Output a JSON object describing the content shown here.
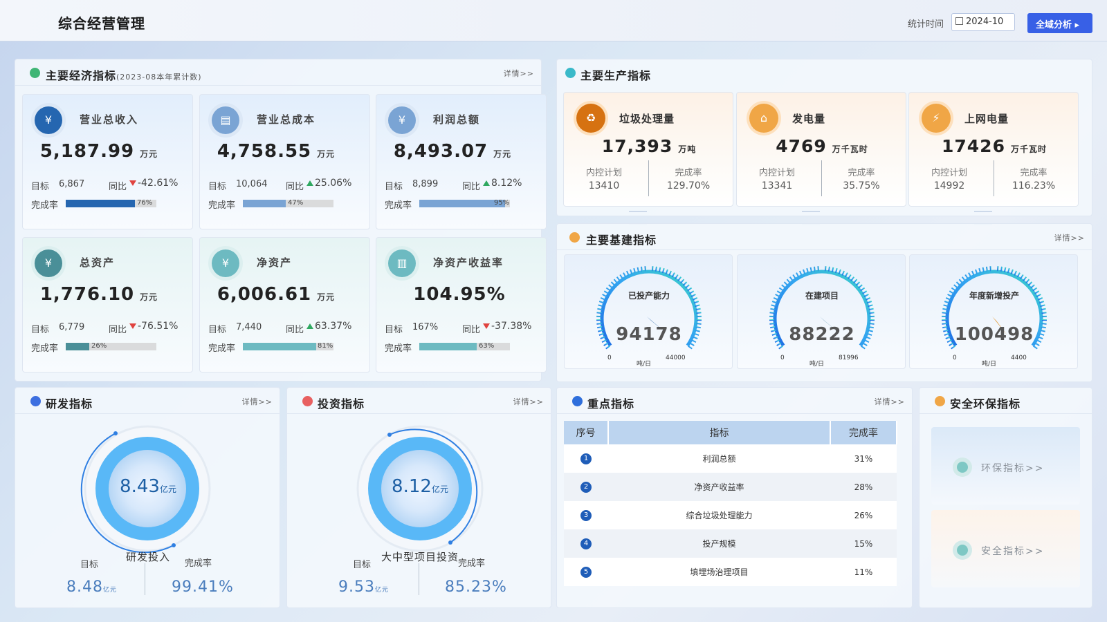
{
  "header": {
    "title": "综合经营管理",
    "stat_label": "统计时间",
    "date": "2024-10",
    "analyze_button": "全域分析 ▸"
  },
  "economic": {
    "title": "主要经济指标",
    "subtitle": "(2023-08本年累计数)",
    "more": "详情>>",
    "cards": [
      {
        "name": "营业总收入",
        "value": "5,187.99",
        "unit": "万元",
        "target_label": "目标",
        "target": "6,867",
        "yoy_label": "同比",
        "yoy_dir": "down",
        "yoy": "-42.61%",
        "rate_label": "完成率",
        "rate": 0.76,
        "rate_text": "76%",
        "color": "#2566b0",
        "icon": "wallet-icon"
      },
      {
        "name": "营业总成本",
        "value": "4,758.55",
        "unit": "万元",
        "target_label": "目标",
        "target": "10,064",
        "yoy_label": "同比",
        "yoy_dir": "up",
        "yoy": "25.06%",
        "rate_label": "完成率",
        "rate": 0.47,
        "rate_text": "47%",
        "color": "#7aa4d4",
        "icon": "printer-icon"
      },
      {
        "name": "利润总额",
        "value": "8,493.07",
        "unit": "万元",
        "target_label": "目标",
        "target": "8,899",
        "yoy_label": "同比",
        "yoy_dir": "up",
        "yoy": "8.12%",
        "rate_label": "完成率",
        "rate": 0.95,
        "rate_text": "95%",
        "color": "#7aa4d4",
        "icon": "yen-coin-icon"
      },
      {
        "name": "总资产",
        "value": "1,776.10",
        "unit": "万元",
        "target_label": "目标",
        "target": "6,779",
        "yoy_label": "同比",
        "yoy_dir": "down",
        "yoy": "-76.51%",
        "rate_label": "完成率",
        "rate": 0.26,
        "rate_text": "26%",
        "color": "#4a8f98",
        "icon": "ledger-icon"
      },
      {
        "name": "净资产",
        "value": "6,006.61",
        "unit": "万元",
        "target_label": "目标",
        "target": "7,440",
        "yoy_label": "同比",
        "yoy_dir": "up",
        "yoy": "63.37%",
        "rate_label": "完成率",
        "rate": 0.81,
        "rate_text": "81%",
        "color": "#6dbac1",
        "icon": "purse-icon"
      },
      {
        "name": "净资产收益率",
        "value": "104.95%",
        "unit": "",
        "target_label": "目标",
        "target": "167%",
        "yoy_label": "同比",
        "yoy_dir": "down",
        "yoy": "-37.38%",
        "rate_label": "完成率",
        "rate": 0.63,
        "rate_text": "63%",
        "color": "#6dbac1",
        "icon": "clipboard-chart-icon"
      }
    ]
  },
  "production": {
    "title": "主要生产指标",
    "cards": [
      {
        "name": "垃圾处理量",
        "value": "17,393",
        "unit": "万吨",
        "plan_label": "内控计划",
        "plan": "13410",
        "rate_label": "完成率",
        "rate": "129.70%",
        "color": "#d67211",
        "icon": "recycle-icon"
      },
      {
        "name": "发电量",
        "value": "4769",
        "unit": "万千瓦时",
        "plan_label": "内控计划",
        "plan": "13341",
        "rate_label": "完成率",
        "rate": "35.75%",
        "color": "#f0a646",
        "icon": "factory-icon"
      },
      {
        "name": "上网电量",
        "value": "17426",
        "unit": "万千瓦时",
        "plan_label": "内控计划",
        "plan": "14992",
        "rate_label": "完成率",
        "rate": "116.23%",
        "color": "#f0a646",
        "icon": "power-tower-icon"
      }
    ]
  },
  "construction": {
    "title": "主要基建指标",
    "more": "详情>>",
    "gauges": [
      {
        "label": "已投产能力",
        "value": "94178",
        "min": "0",
        "max": "44000",
        "unit": "吨/日",
        "pointer_color": "#6d97c7"
      },
      {
        "label": "在建项目",
        "value": "88222",
        "min": "0",
        "max": "81996",
        "unit": "吨/日",
        "pointer_color": "#a9c8d8"
      },
      {
        "label": "年度新增投产",
        "value": "100498",
        "min": "0",
        "max": "4400",
        "unit": "吨/日",
        "pointer_color": "#e4a040"
      }
    ]
  },
  "rnd": {
    "title": "研发指标",
    "more": "详情>>",
    "value": "8.43",
    "value_unit": "亿元",
    "name": "研发投入",
    "target_label": "目标",
    "target": "8.48",
    "target_unit": "亿元",
    "rate_label": "完成率",
    "rate": "99.41%"
  },
  "invest": {
    "title": "投资指标",
    "more": "详情>>",
    "value": "8.12",
    "value_unit": "亿元",
    "name": "大中型项目投资",
    "target_label": "目标",
    "target": "9.53",
    "target_unit": "亿元",
    "rate_label": "完成率",
    "rate": "85.23%"
  },
  "key": {
    "title": "重点指标",
    "more": "详情>>",
    "columns": [
      "序号",
      "指标",
      "完成率"
    ],
    "rows": [
      {
        "no": "1",
        "name": "利润总额",
        "rate": "31%"
      },
      {
        "no": "2",
        "name": "净资产收益率",
        "rate": "28%"
      },
      {
        "no": "3",
        "name": "综合垃圾处理能力",
        "rate": "26%"
      },
      {
        "no": "4",
        "name": "投产规模",
        "rate": "15%"
      },
      {
        "no": "5",
        "name": "填埋场治理项目",
        "rate": "11%"
      }
    ]
  },
  "safety": {
    "title": "安全环保指标",
    "env": "环保指标>>",
    "safe": "安全指标>>"
  }
}
